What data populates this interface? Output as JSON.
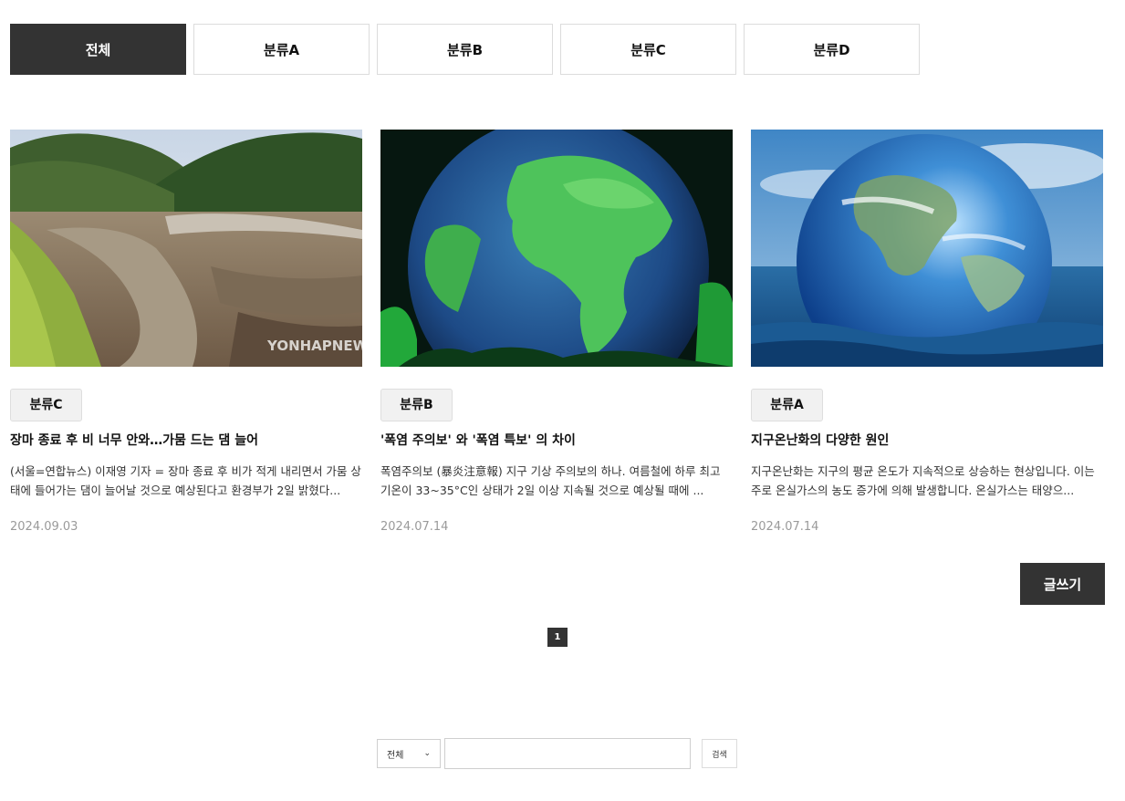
{
  "tabs": [
    {
      "label": "전체",
      "active": true
    },
    {
      "label": "분류A",
      "active": false
    },
    {
      "label": "분류B",
      "active": false
    },
    {
      "label": "분류C",
      "active": false
    },
    {
      "label": "분류D",
      "active": false
    }
  ],
  "posts": [
    {
      "category": "분류C",
      "title": "장마 종료 후 비 너무 안와…가뭄 드는 댐 늘어",
      "excerpt": "(서울=연합뉴스) 이재영 기자 = 장마 종료 후 비가 적게 내리면서 가뭄 상태에 들어가는 댐이 늘어날 것으로 예상된다고 환경부가 2일 밝혔다...",
      "date": "2024.09.03",
      "image_watermark": "YONHAPNEWS",
      "image_icon": "dry-riverbed-photo"
    },
    {
      "category": "분류B",
      "title": "'폭염 주의보' 와 '폭염 특보' 의 차이",
      "excerpt": "폭염주의보 (暴炎注意報) 지구 기상 주의보의 하나. 여름철에 하루 최고 기온이 33~35°C인 상태가 2일 이상 지속될 것으로 예상될 때에 ...",
      "date": "2024.07.14",
      "image_icon": "green-globe-photo"
    },
    {
      "category": "분류A",
      "title": "지구온난화의 다양한 원인",
      "excerpt": "지구온난화는 지구의 평균 온도가 지속적으로 상승하는 현상입니다. 이는 주로 온실가스의 농도 증가에 의해 발생합니다. 온실가스는 태양으...",
      "date": "2024.07.14",
      "image_icon": "globe-in-ocean-photo"
    }
  ],
  "actions": {
    "write_label": "글쓰기"
  },
  "pagination": {
    "current": "1"
  },
  "search": {
    "scope": "전체",
    "query": "",
    "button_label": "검색"
  },
  "colors": {
    "dark": "#333333",
    "border": "#dcdcdc",
    "badge_bg": "#f1f1f1",
    "date": "#9a9a9a"
  }
}
